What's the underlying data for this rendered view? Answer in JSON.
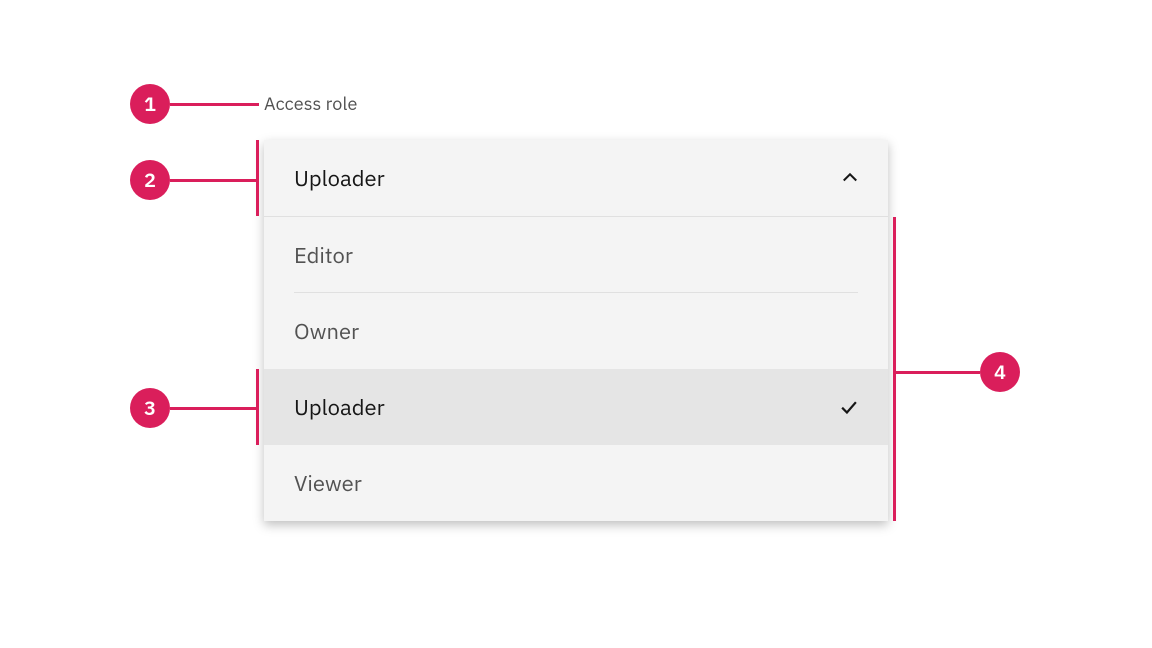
{
  "colors": {
    "annotation": "#da1e5b",
    "field_bg": "#f4f4f4",
    "selected_bg": "#e5e5e5",
    "text_primary": "#161616",
    "text_secondary": "#525252"
  },
  "dropdown": {
    "label": "Access role",
    "selected_value": "Uploader",
    "options": [
      {
        "label": "Editor",
        "selected": false
      },
      {
        "label": "Owner",
        "selected": false
      },
      {
        "label": "Uploader",
        "selected": true
      },
      {
        "label": "Viewer",
        "selected": false
      }
    ]
  },
  "annotations": {
    "a1": "1",
    "a2": "2",
    "a3": "3",
    "a4": "4"
  }
}
